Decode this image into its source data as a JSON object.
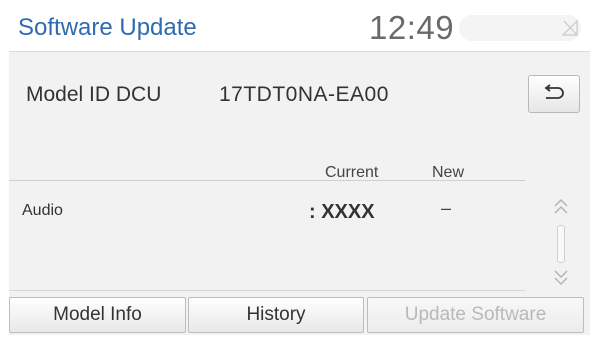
{
  "header": {
    "title": "Software Update",
    "clock": "12:49",
    "status_icon": "no-signal-icon",
    "accent_color": "#2e6bb0"
  },
  "model": {
    "label": "Model ID DCU",
    "value": "17TDT0NA-EA00",
    "back_icon": "back-arrow-icon"
  },
  "table": {
    "columns": {
      "current": "Current",
      "new": "New"
    },
    "rows": [
      {
        "name": "Audio",
        "current": ": XXXX",
        "new": "–"
      }
    ]
  },
  "scroll": {
    "up_icon": "double-chevron-up-icon",
    "down_icon": "double-chevron-down-icon"
  },
  "footer": {
    "model_info": "Model Info",
    "history": "History",
    "update_software": "Update Software"
  }
}
